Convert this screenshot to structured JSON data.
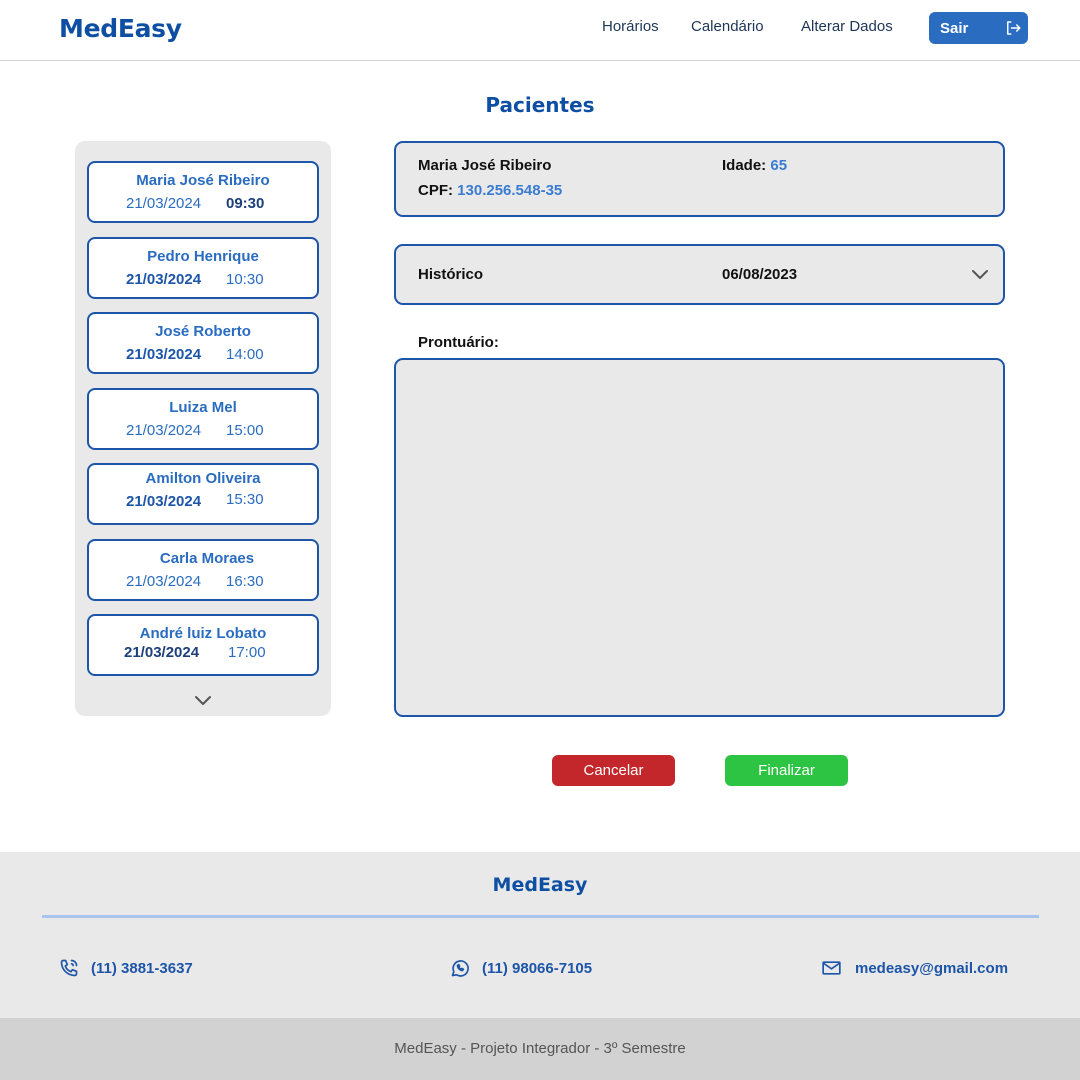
{
  "header": {
    "logo": "MedEasy",
    "nav": [
      "Horários",
      "Calendário",
      "Alterar Dados"
    ],
    "exit_label": "Sair",
    "exit_icon": "logout-icon"
  },
  "page_title": "Pacientes",
  "patients": [
    {
      "name": "Maria José Ribeiro",
      "date": "21/03/2024",
      "time": "09:30"
    },
    {
      "name": "Pedro Henrique",
      "date": "21/03/2024",
      "time": "10:30"
    },
    {
      "name": "José Roberto",
      "date": "21/03/2024",
      "time": "14:00"
    },
    {
      "name": "Luiza Mel",
      "date": "21/03/2024",
      "time": "15:00"
    },
    {
      "name": "Amilton Oliveira",
      "date": "21/03/2024",
      "time": "15:30"
    },
    {
      "name": "Carla Moraes",
      "date": "21/03/2024",
      "time": "16:30"
    },
    {
      "name": "André luiz Lobato",
      "date": "21/03/2024",
      "time": "17:00"
    }
  ],
  "selected_patient": {
    "name": "Maria José Ribeiro",
    "age_label": "Idade:",
    "age": "65",
    "cpf_label": "CPF:",
    "cpf": "130.256.548-35"
  },
  "history": {
    "label": "Histórico",
    "date": "06/08/2023"
  },
  "record": {
    "label": "Prontuário:",
    "value": ""
  },
  "actions": {
    "cancel_label": "Cancelar",
    "finish_label": "Finalizar"
  },
  "footer": {
    "logo": "MedEasy",
    "phone": "(11) 3881-3637",
    "whatsapp": "(11) 98066-7105",
    "email": "medeasy@gmail.com",
    "copyright": "MedEasy - Projeto Integrador - 3º Semestre"
  },
  "colors": {
    "brand_blue": "#0e4fa3",
    "accent_blue": "#2a6cc0",
    "cancel_red": "#c3272b",
    "finish_green": "#2dc443",
    "panel_gray": "#e9e9ea"
  }
}
